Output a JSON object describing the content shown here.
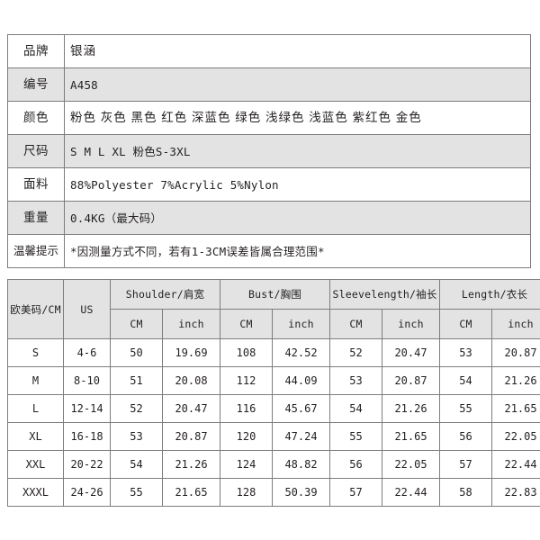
{
  "info": {
    "rows": [
      {
        "label": "品牌",
        "value": "银涵",
        "cjk": true
      },
      {
        "label": "编号",
        "value": "A458",
        "cjk": false
      },
      {
        "label": "颜色",
        "value": "粉色 灰色 黑色 红色 深蓝色 绿色 浅绿色 浅蓝色 紫红色 金色",
        "cjk": true
      },
      {
        "label": "尺码",
        "value": "S M L XL  粉色S-3XL",
        "cjk": false
      },
      {
        "label": "面料",
        "value": "88%Polyester  7%Acrylic  5%Nylon",
        "cjk": false
      },
      {
        "label": "重量",
        "value": "0.4KG（最大码）",
        "cjk": false
      },
      {
        "label": "温馨提示",
        "value": "*因测量方式不同，若有1-3CM误差皆属合理范围*",
        "cjk": false
      }
    ]
  },
  "size_chart": {
    "group_headers": [
      "欧美码/CM",
      "US",
      "Shoulder/肩宽",
      "Bust/胸围",
      "Sleevelength/袖长",
      "Length/衣长"
    ],
    "unit_headers": [
      "",
      "",
      "CM",
      "inch",
      "CM",
      "inch",
      "CM",
      "inch",
      "CM",
      "inch"
    ],
    "rows": [
      {
        "size": "S",
        "us": "4-6",
        "shoulder_cm": "50",
        "shoulder_in": "19.69",
        "bust_cm": "108",
        "bust_in": "42.52",
        "sleeve_cm": "52",
        "sleeve_in": "20.47",
        "length_cm": "53",
        "length_in": "20.87"
      },
      {
        "size": "M",
        "us": "8-10",
        "shoulder_cm": "51",
        "shoulder_in": "20.08",
        "bust_cm": "112",
        "bust_in": "44.09",
        "sleeve_cm": "53",
        "sleeve_in": "20.87",
        "length_cm": "54",
        "length_in": "21.26"
      },
      {
        "size": "L",
        "us": "12-14",
        "shoulder_cm": "52",
        "shoulder_in": "20.47",
        "bust_cm": "116",
        "bust_in": "45.67",
        "sleeve_cm": "54",
        "sleeve_in": "21.26",
        "length_cm": "55",
        "length_in": "21.65"
      },
      {
        "size": "XL",
        "us": "16-18",
        "shoulder_cm": "53",
        "shoulder_in": "20.87",
        "bust_cm": "120",
        "bust_in": "47.24",
        "sleeve_cm": "55",
        "sleeve_in": "21.65",
        "length_cm": "56",
        "length_in": "22.05"
      },
      {
        "size": "XXL",
        "us": "20-22",
        "shoulder_cm": "54",
        "shoulder_in": "21.26",
        "bust_cm": "124",
        "bust_in": "48.82",
        "sleeve_cm": "56",
        "sleeve_in": "22.05",
        "length_cm": "57",
        "length_in": "22.44"
      },
      {
        "size": "XXXL",
        "us": "24-26",
        "shoulder_cm": "55",
        "shoulder_in": "21.65",
        "bust_cm": "128",
        "bust_in": "50.39",
        "sleeve_cm": "57",
        "sleeve_in": "22.44",
        "length_cm": "58",
        "length_in": "22.83"
      }
    ]
  },
  "colors": {
    "border": "#7d7d7d",
    "shade": "#e3e3e3",
    "text": "#231f20",
    "background": "#ffffff"
  }
}
